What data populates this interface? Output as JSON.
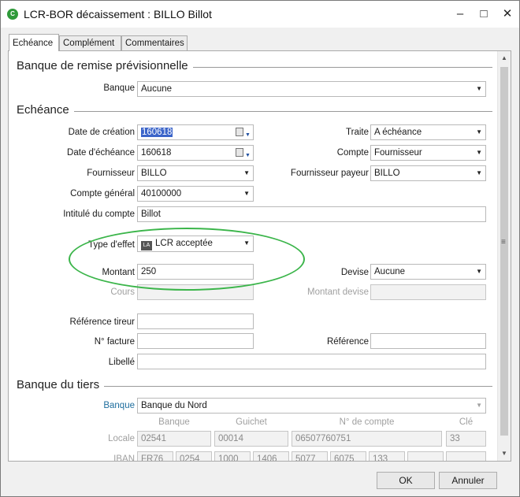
{
  "window": {
    "title": "LCR-BOR décaissement : BILLO Billot",
    "app_icon_text": "C"
  },
  "tabs": [
    "Echéance",
    "Complément",
    "Commentaires"
  ],
  "sections": {
    "banque_remise": "Banque de remise prévisionnelle",
    "echeance": "Echéance",
    "banque_tiers": "Banque du tiers"
  },
  "banque_remise": {
    "banque_label": "Banque",
    "banque_value": "Aucune"
  },
  "echeance": {
    "date_creation_label": "Date de création",
    "date_creation_value": "160618",
    "date_echeance_label": "Date d'échéance",
    "date_echeance_value": "160618",
    "fournisseur_label": "Fournisseur",
    "fournisseur_value": "BILLO",
    "compte_general_label": "Compte général",
    "compte_general_value": "40100000",
    "intitule_label": "Intitulé du compte",
    "intitule_value": "Billot",
    "type_effet_label": "Type d'effet",
    "type_effet_icon": "LA",
    "type_effet_value": "LCR acceptée",
    "montant_label": "Montant",
    "montant_value": "250",
    "cours_label": "Cours",
    "cours_value": "",
    "reference_tireur_label": "Référence tireur",
    "reference_tireur_value": "",
    "n_facture_label": "N° facture",
    "n_facture_value": "",
    "libelle_label": "Libellé",
    "libelle_value": "",
    "traite_label": "Traite",
    "traite_value": "A échéance",
    "compte_label": "Compte",
    "compte_value": "Fournisseur",
    "fournisseur_payeur_label": "Fournisseur payeur",
    "fournisseur_payeur_value": "BILLO",
    "devise_label": "Devise",
    "devise_value": "Aucune",
    "montant_devise_label": "Montant devise",
    "montant_devise_value": "",
    "reference_label": "Référence",
    "reference_value": ""
  },
  "banque_tiers": {
    "banque_label": "Banque",
    "banque_value": "Banque du Nord",
    "headers": {
      "banque": "Banque",
      "guichet": "Guichet",
      "n_compte": "N° de compte",
      "cle": "Clé"
    },
    "locale_label": "Locale",
    "locale": {
      "banque": "02541",
      "guichet": "00014",
      "n_compte": "06507760751",
      "cle": "33"
    },
    "iban_label": "IBAN",
    "iban": [
      "FR76",
      "0254",
      "1000",
      "1406",
      "5077",
      "6075",
      "133",
      "",
      ""
    ]
  },
  "buttons": {
    "ok": "OK",
    "annuler": "Annuler"
  },
  "colors": {
    "annotation": "#3bb54a",
    "selection": "#3b64c9",
    "link": "#1f6e9e"
  }
}
